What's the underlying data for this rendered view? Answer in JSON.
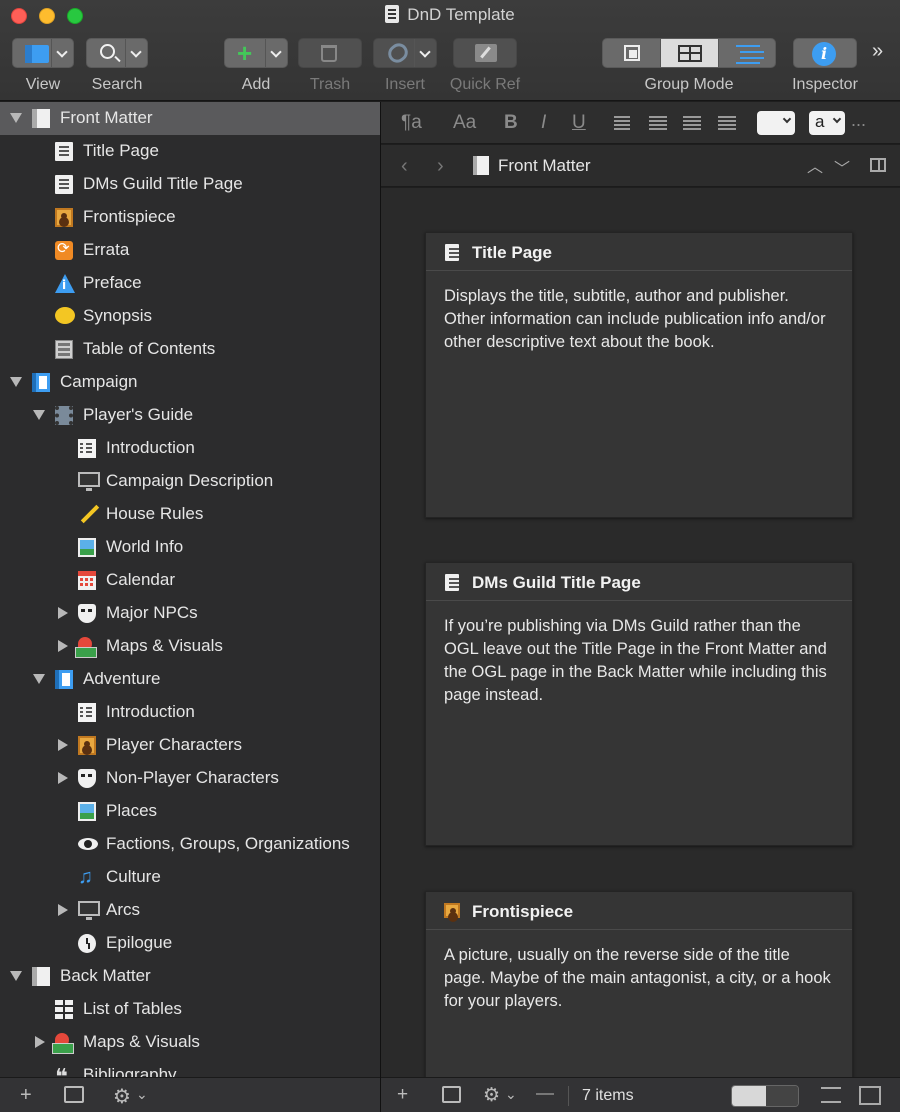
{
  "window": {
    "title": "DnD Template"
  },
  "toolbar": {
    "view_label": "View",
    "search_label": "Search",
    "add_label": "Add",
    "trash_label": "Trash",
    "insert_label": "Insert",
    "quickref_label": "Quick Ref",
    "group_mode_label": "Group Mode",
    "inspector_label": "Inspector",
    "more_glyph": "»",
    "add_glyph": "+",
    "inspector_glyph": "i"
  },
  "binder": {
    "items": [
      {
        "label": "Front Matter",
        "icon": "book-icon",
        "state": "open",
        "selected": true
      },
      {
        "label": "Title Page",
        "icon": "document-icon"
      },
      {
        "label": "DMs Guild Title Page",
        "icon": "document-icon"
      },
      {
        "label": "Frontispiece",
        "icon": "portrait-icon"
      },
      {
        "label": "Errata",
        "icon": "errata-icon"
      },
      {
        "label": "Preface",
        "icon": "info-icon"
      },
      {
        "label": "Synopsis",
        "icon": "speech-bubble-icon"
      },
      {
        "label": "Table of Contents",
        "icon": "toc-icon"
      },
      {
        "label": "Campaign",
        "icon": "book-icon",
        "state": "open"
      },
      {
        "label": "Player's Guide",
        "icon": "film-icon",
        "state": "open"
      },
      {
        "label": "Introduction",
        "icon": "list-icon"
      },
      {
        "label": "Campaign Description",
        "icon": "monitor-icon"
      },
      {
        "label": "House Rules",
        "icon": "pencil-icon"
      },
      {
        "label": "World Info",
        "icon": "picture-icon"
      },
      {
        "label": "Calendar",
        "icon": "calendar-icon"
      },
      {
        "label": "Major NPCs",
        "icon": "mask-icon",
        "state": "closed"
      },
      {
        "label": "Maps & Visuals",
        "icon": "map-icon",
        "state": "closed"
      },
      {
        "label": "Adventure",
        "icon": "book-icon",
        "state": "open"
      },
      {
        "label": "Introduction",
        "icon": "list-icon"
      },
      {
        "label": "Player Characters",
        "icon": "portrait-icon",
        "state": "closed"
      },
      {
        "label": "Non-Player Characters",
        "icon": "mask-icon",
        "state": "closed"
      },
      {
        "label": "Places",
        "icon": "picture-icon"
      },
      {
        "label": "Factions, Groups, Organizations",
        "icon": "eye-icon"
      },
      {
        "label": "Culture",
        "icon": "music-note-icon"
      },
      {
        "label": "Arcs",
        "icon": "monitor-icon",
        "state": "closed"
      },
      {
        "label": "Epilogue",
        "icon": "clock-icon"
      },
      {
        "label": "Back Matter",
        "icon": "book-icon",
        "state": "open"
      },
      {
        "label": "List of Tables",
        "icon": "table-icon"
      },
      {
        "label": "Maps & Visuals",
        "icon": "map-icon",
        "state": "closed"
      },
      {
        "label": "Bibliography",
        "icon": "quote-icon"
      }
    ]
  },
  "format_bar": {
    "paragraph_glyph": "¶a",
    "font_glyph": "Aa",
    "bold": "B",
    "italic": "I",
    "underline": "U",
    "text_color_letter": "a",
    "more": "..."
  },
  "header": {
    "back_glyph": "‹",
    "forward_glyph": "›",
    "title": "Front Matter",
    "up_glyph": "︿",
    "down_glyph": "﹀"
  },
  "corkboard": {
    "cards": [
      {
        "title": "Title Page",
        "icon": "document-icon",
        "synopsis": "Displays the title, subtitle, author and publisher. Other information can include  publication info and/or other descriptive text about the book."
      },
      {
        "title": "DMs Guild Title Page",
        "icon": "document-icon",
        "synopsis": "If you’re publishing via DMs Guild rather than the OGL leave out the Title Page in the Front Matter and the OGL page in the Back Matter while including this page instead."
      },
      {
        "title": "Frontispiece",
        "icon": "portrait-icon",
        "synopsis": "A picture, usually on the reverse side of the title page.  Maybe of the main antagonist, a city, or a hook for your players."
      }
    ]
  },
  "footer": {
    "item_count": "7 items",
    "add_glyph": "+",
    "gear_glyph": "⚙",
    "chevron_glyph": "⌄"
  }
}
